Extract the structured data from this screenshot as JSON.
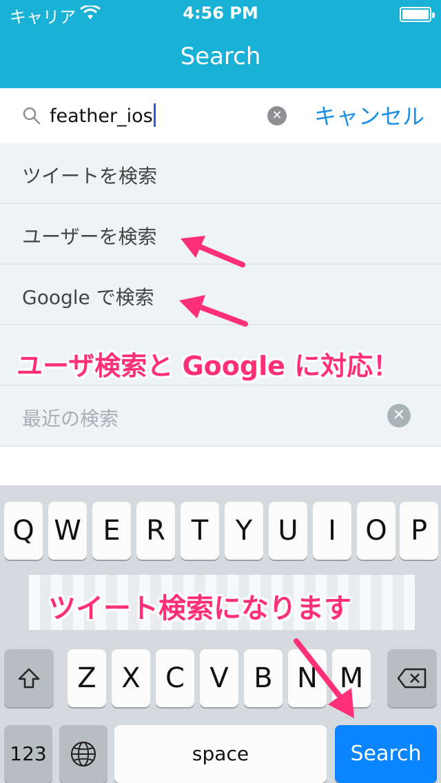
{
  "status": {
    "carrier": "キャリア",
    "time": "4:56 PM"
  },
  "header": {
    "title": "Search"
  },
  "search": {
    "query": "feather_ios",
    "clear_icon": "clear-circle-icon",
    "cancel_label": "キャンセル"
  },
  "results": [
    {
      "label": "ツイートを検索"
    },
    {
      "label": "ユーザーを検索"
    },
    {
      "label": "Google で検索"
    },
    {
      "label": ""
    }
  ],
  "recent": {
    "label": "最近の検索"
  },
  "annotations": {
    "top": "ユーザ検索と Google に対応！",
    "bottom": "ツイート検索になります",
    "color": "#ff2f78"
  },
  "keyboard": {
    "row1": [
      "Q",
      "W",
      "E",
      "R",
      "T",
      "Y",
      "U",
      "I",
      "O",
      "P"
    ],
    "row3": [
      "Z",
      "X",
      "C",
      "V",
      "B",
      "N",
      "M"
    ],
    "num_label": "123",
    "space_label": "space",
    "go_label": "Search"
  },
  "colors": {
    "header": "#19b2d6",
    "accent": "#1b8fe8",
    "go": "#0a84ff"
  }
}
